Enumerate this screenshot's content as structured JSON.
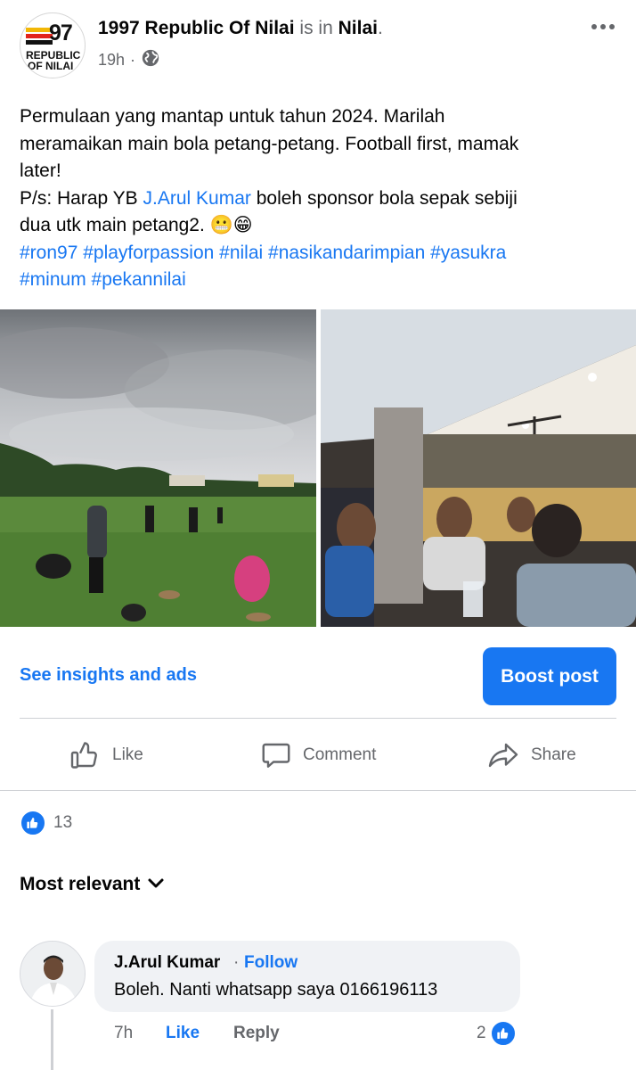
{
  "post": {
    "page_name": "1997 Republic Of Nilai",
    "is_in_text": "is in",
    "location": "Nilai",
    "period": ".",
    "time": "19h",
    "time_separator": "·",
    "privacy_icon": "globe-icon",
    "logo": {
      "number": "97",
      "line1": "REPUBLIC",
      "line2": "OF NILAI"
    },
    "text_line1": "Permulaan yang mantap untuk tahun 2024. Marilah",
    "text_line2": "meramaikan main bola petang-petang. Football first, mamak",
    "text_line3": "later!",
    "text_line4_prefix": "P/s: Harap YB ",
    "text_mention": "J.Arul Kumar",
    "text_line4_suffix": " boleh sponsor bola sepak sebiji",
    "text_line5": "dua utk main petang2. 😬😁",
    "hashtags_line1": "#ron97 #playforpassion #nilai #nasikandarimpian #yasukra",
    "hashtags_line2": "#minum #pekannilai"
  },
  "insights": {
    "link_label": "See insights and ads",
    "boost_label": "Boost post"
  },
  "actions": {
    "like": "Like",
    "comment": "Comment",
    "share": "Share"
  },
  "reactions": {
    "count": "13"
  },
  "sort": {
    "label": "Most relevant"
  },
  "comment": {
    "author": "J.Arul Kumar",
    "separator": "·",
    "follow": "Follow",
    "text": "Boleh. Nanti whatsapp saya 0166196113",
    "time": "7h",
    "like": "Like",
    "reply": "Reply",
    "reaction_count": "2"
  },
  "colors": {
    "accent": "#1877f2",
    "muted": "#65676b",
    "bubble": "#f0f2f5",
    "divider": "#ced0d4"
  }
}
